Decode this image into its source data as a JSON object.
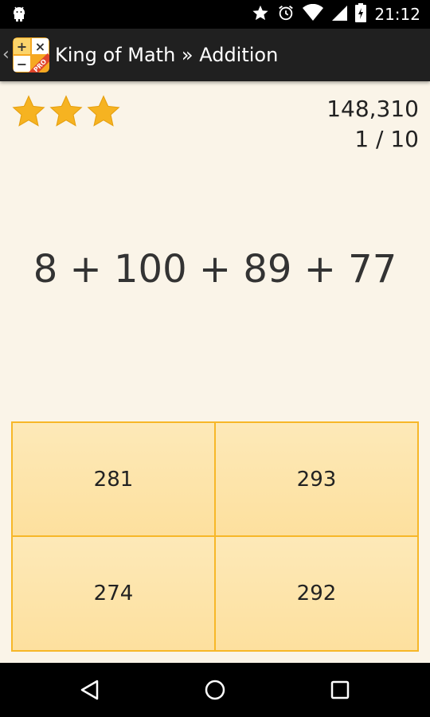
{
  "status_bar": {
    "time": "21:12",
    "icons": [
      "android-icon",
      "star-icon",
      "alarm-icon",
      "wifi-icon",
      "signal-icon",
      "battery-icon"
    ]
  },
  "action_bar": {
    "title": "King of Math » Addition",
    "logo_badge": "PRO",
    "logo_symbols": [
      "+",
      "×",
      "−",
      ""
    ]
  },
  "game": {
    "stars": 3,
    "score": "148,310",
    "progress": "1 / 10",
    "problem": "8 + 100 + 89 + 77",
    "answers": [
      "281",
      "293",
      "274",
      "292"
    ]
  },
  "colors": {
    "background": "#faf4e8",
    "star": "#f6b321",
    "answer_border": "#f7b728",
    "answer_fill": "#fde6ae",
    "action_bar": "#202020"
  },
  "nav_bar": {
    "icons": [
      "back-triangle-icon",
      "home-circle-icon",
      "recents-square-icon"
    ]
  }
}
